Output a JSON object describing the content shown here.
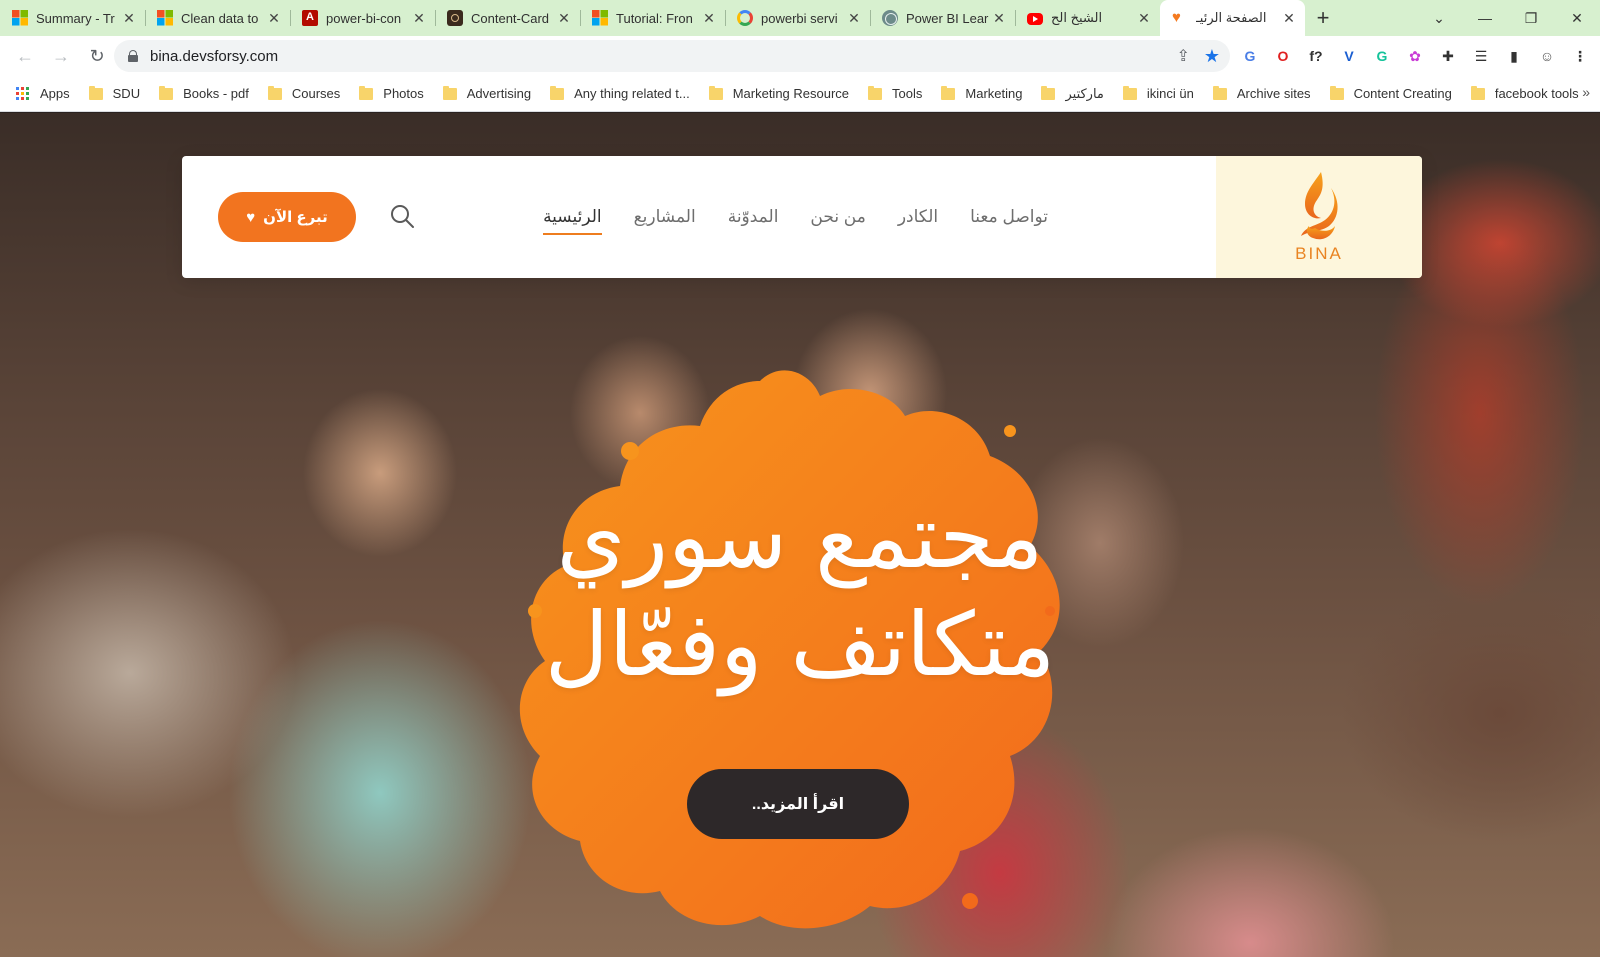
{
  "tabs": [
    {
      "title": "Summary - Tr",
      "icon": "microsoft-icon",
      "close": "✕"
    },
    {
      "title": "Clean data to",
      "icon": "microsoft-icon",
      "close": "✕"
    },
    {
      "title": "power-bi-con",
      "icon": "pdf-icon",
      "close": "✕"
    },
    {
      "title": "Content-Card",
      "icon": "content-card-icon",
      "close": "✕"
    },
    {
      "title": "Tutorial: Fron",
      "icon": "microsoft-icon",
      "close": "✕"
    },
    {
      "title": "powerbi servi",
      "icon": "google-icon",
      "close": "✕"
    },
    {
      "title": "Power BI Lear",
      "icon": "ai-icon",
      "close": "✕"
    },
    {
      "title": "الشيخ الح",
      "icon": "youtube-icon",
      "close": "✕"
    },
    {
      "title": "الصفحة الرئيـ",
      "icon": "heart-icon",
      "close": "✕",
      "active": true
    }
  ],
  "new_tab": "+",
  "window_controls": {
    "menu": "⌄",
    "minimize": "—",
    "maximize": "❐",
    "close": "✕"
  },
  "toolbar": {
    "back": "←",
    "forward": "→",
    "reload": "↻",
    "url": "bina.devsforsy.com",
    "share": "⇪",
    "bookmark_star": "★"
  },
  "extensions": [
    {
      "name": "translate-extension-icon",
      "glyph": "G",
      "color": "#4a7ee6"
    },
    {
      "name": "opera-extension-icon",
      "glyph": "O",
      "color": "#e02020"
    },
    {
      "name": "formula-extension-icon",
      "glyph": "f?",
      "color": "#333333"
    },
    {
      "name": "vue-extension-icon",
      "glyph": "V",
      "color": "#1b5fd1"
    },
    {
      "name": "grammarly-extension-icon",
      "glyph": "G",
      "color": "#15c39a"
    },
    {
      "name": "color-extension-icon",
      "glyph": "✿",
      "color": "#c93bd6"
    },
    {
      "name": "puzzle-extension-icon",
      "glyph": "✚",
      "color": "#333333"
    },
    {
      "name": "reading-list-icon",
      "glyph": "☰",
      "color": "#333333"
    },
    {
      "name": "side-panel-icon",
      "glyph": "▮",
      "color": "#333333"
    },
    {
      "name": "profile-avatar-icon",
      "glyph": "☺",
      "color": "#555555"
    },
    {
      "name": "chrome-menu-icon",
      "glyph": "⋮",
      "color": "#333333"
    }
  ],
  "bookmarks": [
    {
      "label": "Apps",
      "type": "apps"
    },
    {
      "label": "SDU",
      "type": "folder"
    },
    {
      "label": "Books - pdf",
      "type": "folder"
    },
    {
      "label": "Courses",
      "type": "folder"
    },
    {
      "label": "Photos",
      "type": "folder"
    },
    {
      "label": "Advertising",
      "type": "folder"
    },
    {
      "label": "Any thing related t...",
      "type": "folder"
    },
    {
      "label": "Marketing Resource",
      "type": "folder"
    },
    {
      "label": "Tools",
      "type": "folder"
    },
    {
      "label": "Marketing",
      "type": "folder"
    },
    {
      "label": "ماركتير",
      "type": "folder"
    },
    {
      "label": "ikinci ün",
      "type": "folder"
    },
    {
      "label": "Archive sites",
      "type": "folder"
    },
    {
      "label": "Content Creating",
      "type": "folder"
    },
    {
      "label": "facebook tools",
      "type": "folder"
    }
  ],
  "bookmarks_more": "»",
  "site": {
    "logo_text": "BINA",
    "menu": [
      {
        "label": "الرئيسية",
        "active": true
      },
      {
        "label": "المشاريع"
      },
      {
        "label": "المدوّنة"
      },
      {
        "label": "من نحن"
      },
      {
        "label": "الكادر"
      },
      {
        "label": "تواصل معنا"
      }
    ],
    "donate_label": "تبرع الآن",
    "hero_line1": "مجتمع سوري",
    "hero_line2": "متكاتف وفعّال",
    "cta_label": "اقرأ المزيد..",
    "colors": {
      "accent": "#f2741f",
      "cta": "#2d2829",
      "logo_bg": "#fdf6dc"
    }
  }
}
